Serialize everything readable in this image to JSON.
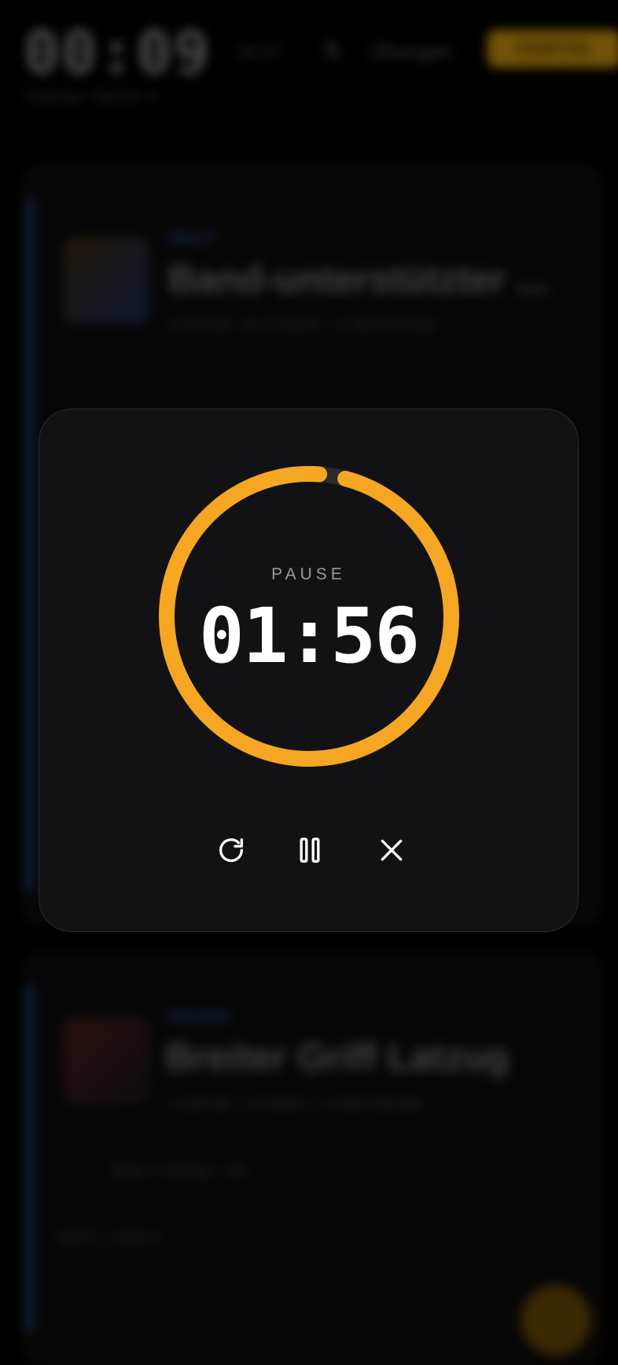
{
  "background": {
    "header": {
      "clock": "00:09",
      "subtitle": "16:57",
      "filter_label": "Übungen",
      "finish_label": "FERTIG"
    },
    "breadcrumb": "Training • Woche 4",
    "cards": [
      {
        "tag": "BRUST",
        "title": "Band-unterstützter ...",
        "meta": "3 SÄTZE • 8-12 WDH. • 2 MIN PAUSE"
      },
      {
        "tag": "RÜCKEN",
        "title": "Breiter Griff Latzug",
        "meta": "3 SÄTZE • 10 WDH. • 2 MIN PAUSE",
        "row": "Satz 1   40 kg   ×   10",
        "section": "SATZ 1 VON 3"
      }
    ]
  },
  "timer": {
    "label": "PAUSE",
    "time": "01:56",
    "progress": 0.97,
    "accent_color": "#F5A623"
  },
  "controls": {
    "restart_icon": "restart-icon",
    "pause_icon": "pause-icon",
    "close_icon": "close-icon"
  }
}
